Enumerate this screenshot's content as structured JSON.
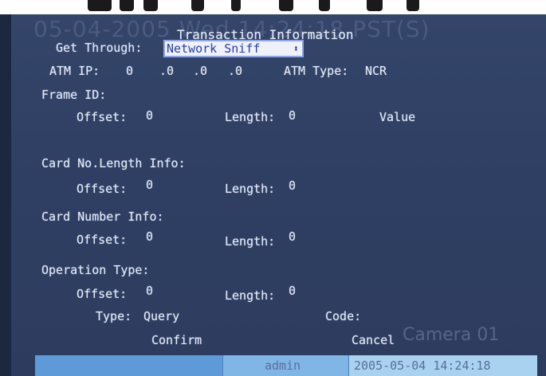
{
  "cut_text": "",
  "osd_background": "05-04-2005 Wed 14:24:18 PST(S)",
  "camera_watermark": "Camera 01",
  "title": "Transaction Information",
  "get_through": {
    "label": "Get Through:",
    "value": "Network Sniff",
    "arrow": "⬍"
  },
  "atm_ip": {
    "label": "ATM IP:",
    "octets": [
      "0",
      ".0",
      ".0",
      ".0"
    ]
  },
  "atm_type": {
    "label": "ATM Type:",
    "value": "NCR"
  },
  "frame_id": {
    "heading": "Frame ID:",
    "offset_label": "Offset:",
    "offset_value": "0",
    "length_label": "Length:",
    "length_value": "0",
    "value_label": "Value"
  },
  "card_no_length": {
    "heading": "Card No.Length Info:",
    "offset_label": "Offset:",
    "offset_value": "0",
    "length_label": "Length:",
    "length_value": "0"
  },
  "card_number": {
    "heading": "Card Number Info:",
    "offset_label": "Offset:",
    "offset_value": "0",
    "length_label": "Length:",
    "length_value": "0"
  },
  "operation_type": {
    "heading": "Operation Type:",
    "offset_label": "Offset:",
    "offset_value": "0",
    "length_label": "Length:",
    "length_value": "0",
    "type_label": "Type:",
    "type_value": "Query",
    "code_label": "Code:"
  },
  "buttons": {
    "confirm": "Confirm",
    "cancel": "Cancel"
  },
  "status_bar": {
    "user": "admin",
    "datetime": "2005-05-04 14:24:18"
  },
  "colors": {
    "screen_bg": "#2f3f63",
    "text": "#e4e8f2",
    "selection_text": "#2a3fa8",
    "status_blue": "#7fb6e6"
  }
}
